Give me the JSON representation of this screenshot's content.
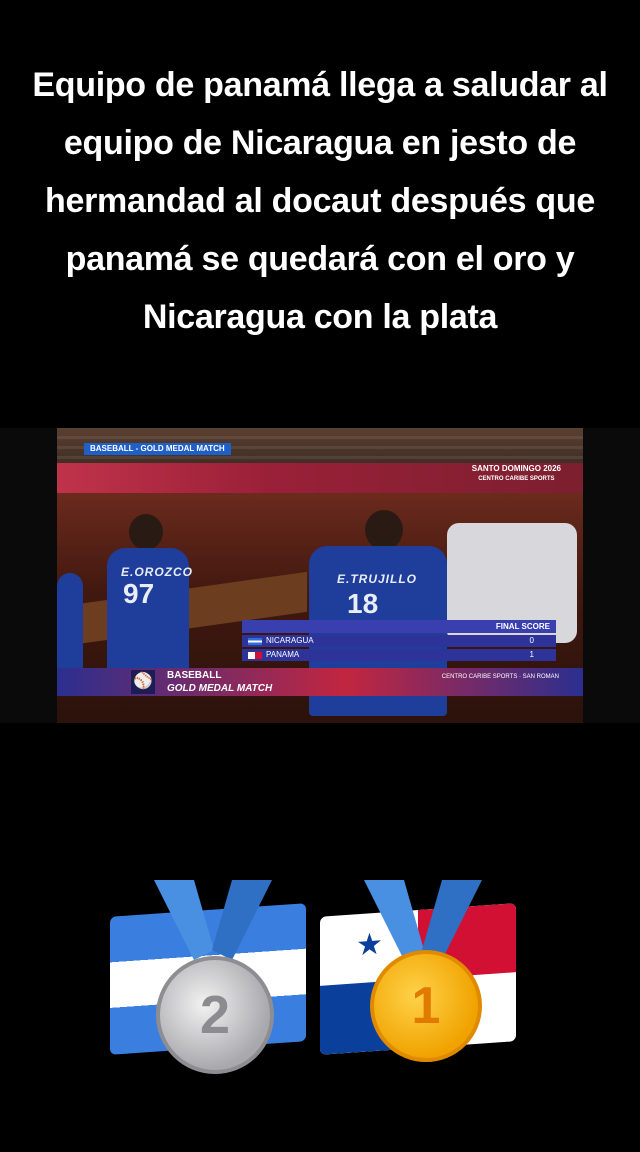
{
  "caption": "Equipo de panamá llega a saludar al equipo de Nicaragua en jesto de hermandad al docaut después que panamá se quedará con el oro y Nicaragua con la plata",
  "video": {
    "tag": "BASEBALL - GOLD MEDAL MATCH",
    "event_logo": "SANTO DOMINGO 2026",
    "sponsor": "CENTRO CARIBE SPORTS",
    "players": [
      {
        "name": "E.OROZCO",
        "number": "97"
      },
      {
        "name": "E.TRUJILLO",
        "number": "18"
      }
    ],
    "scoreboard": {
      "header": "FINAL SCORE",
      "rows": [
        {
          "team": "NICARAGUA",
          "runs": "0"
        },
        {
          "team": "PANAMA",
          "runs": "1"
        }
      ]
    },
    "lower_third": {
      "line1": "BASEBALL",
      "line2": "GOLD MEDAL MATCH",
      "right": "CENTRO CARIBE SPORTS · SAN ROMAN"
    }
  },
  "medals": {
    "silver_number": "2",
    "gold_number": "1"
  }
}
